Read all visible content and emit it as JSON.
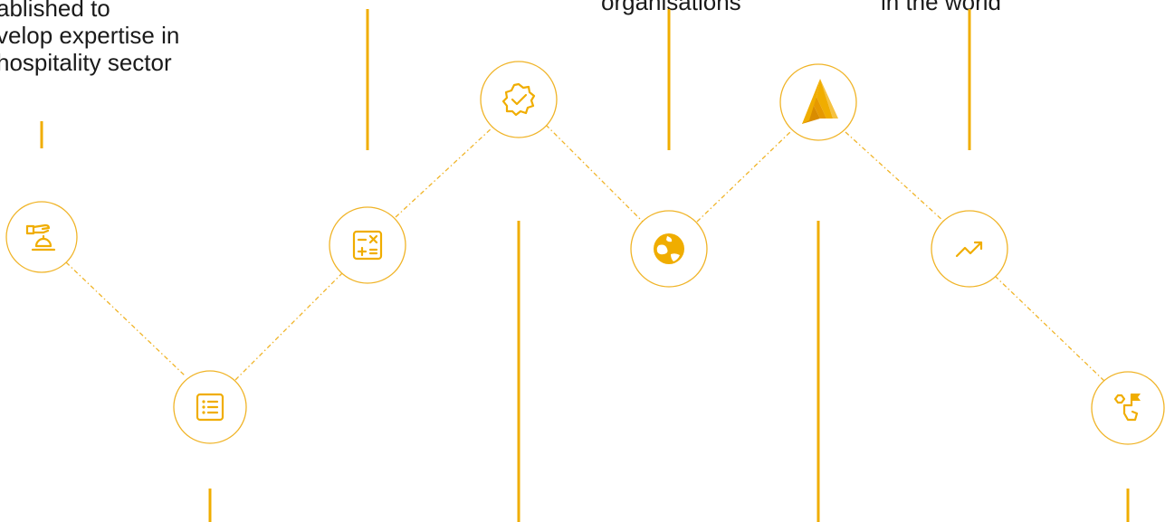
{
  "captions": {
    "c1": [
      "ablished to",
      "velop expertise in",
      " hospitality sector"
    ],
    "c2": [
      "organisations"
    ],
    "c3": [
      "in the world"
    ]
  },
  "nodes": [
    {
      "icon": "hand-service-bell-icon"
    },
    {
      "icon": "checklist-icon"
    },
    {
      "icon": "calculator-icon"
    },
    {
      "icon": "badge-check-icon"
    },
    {
      "icon": "globe-icon"
    },
    {
      "icon": "triangle-logo-icon"
    },
    {
      "icon": "trend-up-icon"
    },
    {
      "icon": "goal-flag-path-icon"
    }
  ],
  "colors": {
    "accent": "#f0ad00",
    "circle_stroke": "#f0b428",
    "text": "#1a1a1a"
  }
}
